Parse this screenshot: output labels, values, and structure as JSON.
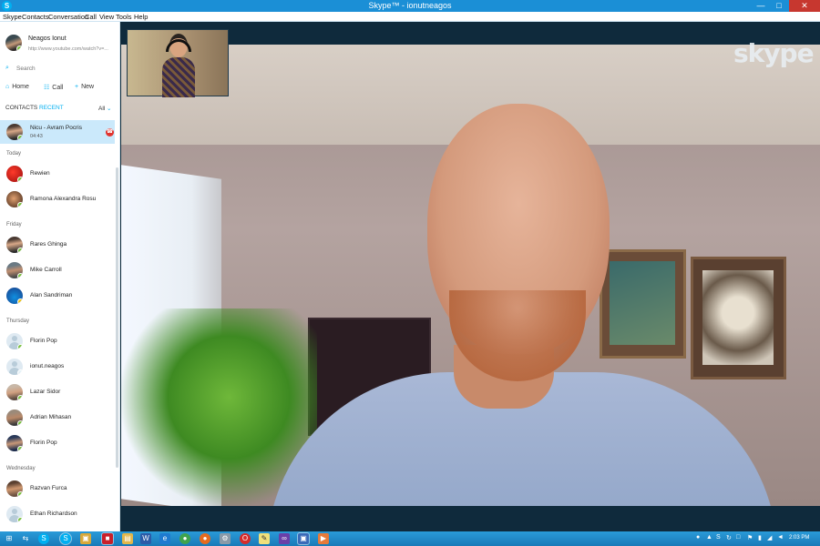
{
  "window": {
    "title": "Skype™ - ionutneagos",
    "min_label": "—",
    "max_label": "□",
    "close_label": "✕"
  },
  "menu": [
    "Skype",
    "Contacts",
    "Conversation",
    "Call",
    "View",
    "Tools",
    "Help"
  ],
  "profile": {
    "name": "Neagos Ionut",
    "mood": "http://www.youtube.com/watch?v=..."
  },
  "search": {
    "placeholder": "Search"
  },
  "actions": {
    "home": "Home",
    "call": "Call",
    "new": "New"
  },
  "tabs": {
    "contacts": "CONTACTS",
    "recent": "RECENT",
    "filter": "All"
  },
  "active_conversation": {
    "name": "Nicu - Avram Pocris",
    "duration": "04:43"
  },
  "groups": {
    "today": "Today",
    "friday": "Friday",
    "thursday": "Thursday",
    "wednesday": "Wednesday"
  },
  "contacts": [
    "Rewien",
    "Ramona Alexandra Rosu",
    "Rares Ghinga",
    "Mike Carroll",
    "Alan Sandriman",
    "Florin Pop",
    "ionut.neagos",
    "Lazar Sidor",
    "Adrian Mihasan",
    "Florin Pop",
    "Razvan Furca",
    "Ethan Richardson"
  ],
  "video": {
    "watermark": "skype"
  },
  "taskbar": {
    "clock": "2:03 PM"
  },
  "colors": {
    "accent": "#00aff0",
    "titlebar": "#1b8fd6",
    "online": "#7cc242"
  }
}
